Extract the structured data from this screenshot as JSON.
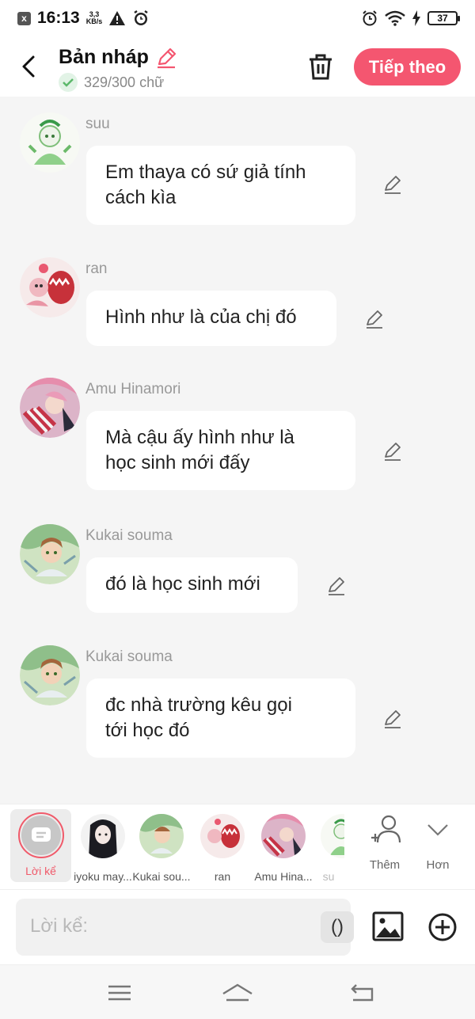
{
  "status_bar": {
    "notif_icon": "x",
    "time": "16:13",
    "net_speed_value": "3,3",
    "net_speed_unit": "KB/s",
    "battery": "37"
  },
  "header": {
    "title": "Bản nháp",
    "word_count": "329/300 chữ",
    "next_label": "Tiếp theo"
  },
  "messages": [
    {
      "name": "suu",
      "lines": [
        "Em thaya có sứ giả tính",
        "cách kìa"
      ]
    },
    {
      "name": "ran",
      "lines": [
        "Hình như là của chị đó"
      ]
    },
    {
      "name": "Amu Hinamori",
      "lines": [
        "Mà cậu ấy hình như là",
        "học sinh mới đấy"
      ]
    },
    {
      "name": "Kukai souma",
      "lines": [
        "đó là học sinh mới"
      ]
    },
    {
      "name": "Kukai souma",
      "lines": [
        "đc nhà trường kêu gọi",
        "tới học đó"
      ]
    }
  ],
  "character_bar": {
    "narrator_label": "Lời kể",
    "chars": [
      "iyoku may...",
      "Kukai sou...",
      "ran",
      "Amu Hina...",
      "su"
    ],
    "add_label": "Thêm",
    "more_label": "Hơn"
  },
  "input": {
    "placeholder": "Lời kể:",
    "paren_label": "()"
  },
  "colors": {
    "accent": "#f45670",
    "ok_green": "#5cb86b"
  }
}
